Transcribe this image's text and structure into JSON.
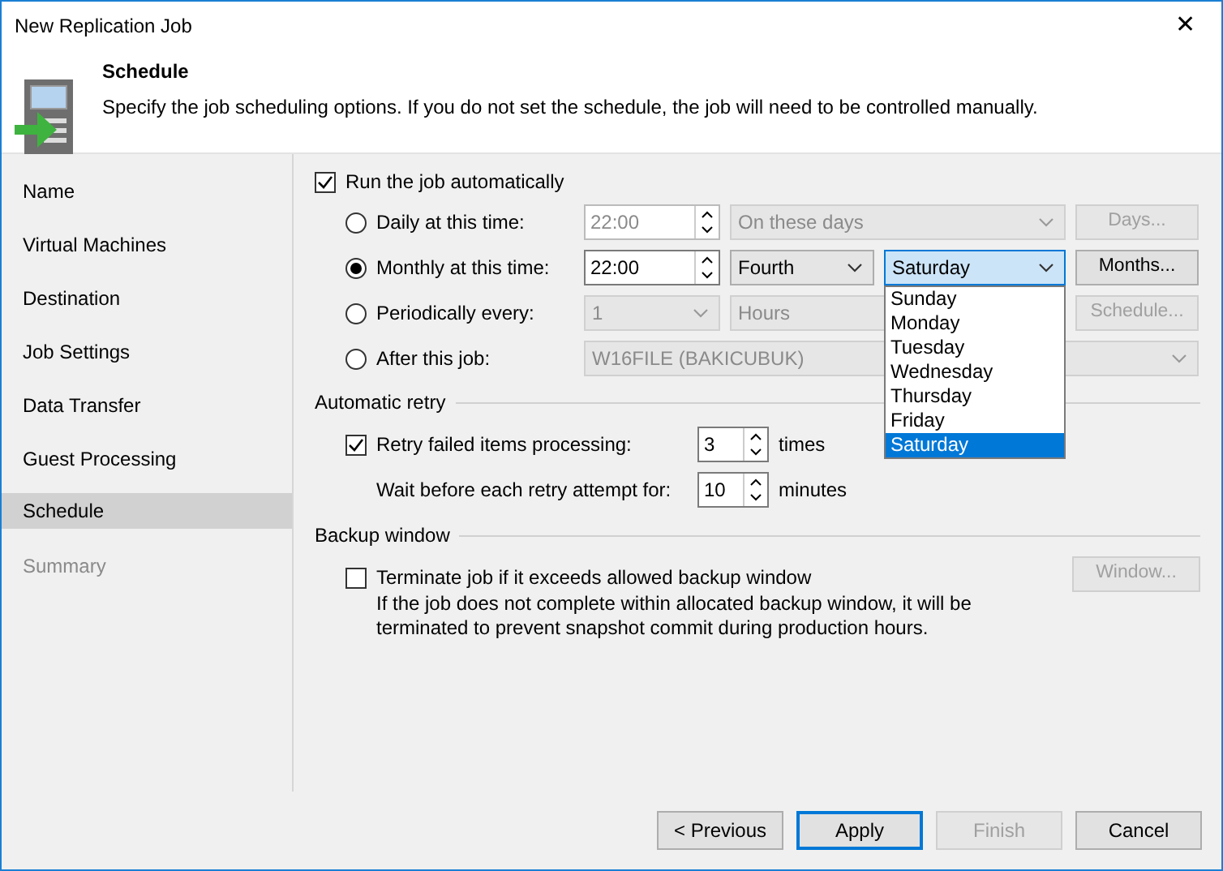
{
  "window": {
    "title": "New Replication Job",
    "close": "✕"
  },
  "header": {
    "title": "Schedule",
    "description": "Specify the job scheduling options. If you do not set the schedule, the job will need to be controlled manually."
  },
  "sidebar": {
    "items": [
      {
        "label": "Name",
        "selected": false,
        "disabled": false
      },
      {
        "label": "Virtual Machines",
        "selected": false,
        "disabled": false
      },
      {
        "label": "Destination",
        "selected": false,
        "disabled": false
      },
      {
        "label": "Job Settings",
        "selected": false,
        "disabled": false
      },
      {
        "label": "Data Transfer",
        "selected": false,
        "disabled": false
      },
      {
        "label": "Guest Processing",
        "selected": false,
        "disabled": false
      },
      {
        "label": "Schedule",
        "selected": true,
        "disabled": false
      },
      {
        "label": "Summary",
        "selected": false,
        "disabled": true
      }
    ]
  },
  "run_automatically": {
    "label": "Run the job automatically",
    "checked": true
  },
  "options": [
    {
      "label": "Daily at this time:",
      "selected": false,
      "controls": [
        {
          "kind": "spinner",
          "value": "22:00",
          "disabled": true
        },
        {
          "kind": "combo-wide",
          "value": "On these days",
          "disabled": true
        },
        {
          "kind": "button",
          "value": "Days...",
          "disabled": true
        }
      ]
    },
    {
      "label": "Monthly at this time:",
      "selected": true,
      "controls": [
        {
          "kind": "spinner",
          "value": "22:00",
          "disabled": false
        },
        {
          "kind": "combo",
          "value": "Fourth",
          "disabled": false
        },
        {
          "kind": "combo",
          "value": "Saturday",
          "disabled": false,
          "focused": true,
          "open_list": [
            {
              "label": "Sunday",
              "selected": false
            },
            {
              "label": "Monday",
              "selected": false
            },
            {
              "label": "Tuesday",
              "selected": false
            },
            {
              "label": "Wednesday",
              "selected": false
            },
            {
              "label": "Thursday",
              "selected": false
            },
            {
              "label": "Friday",
              "selected": false
            },
            {
              "label": "Saturday",
              "selected": true
            }
          ]
        },
        {
          "kind": "button",
          "value": "Months...",
          "disabled": false
        }
      ]
    },
    {
      "label": "Periodically every:",
      "selected": false,
      "controls": [
        {
          "kind": "combo",
          "value": "1",
          "disabled": true
        },
        {
          "kind": "combo-wide",
          "value": "Hours",
          "disabled": true
        },
        {
          "kind": "button",
          "value": "Schedule...",
          "disabled": true
        }
      ]
    },
    {
      "label": "After this job:",
      "selected": false,
      "controls": [
        {
          "kind": "combo-full",
          "value": "W16FILE (BAKICUBUK)",
          "disabled": true
        }
      ]
    }
  ],
  "automatic_retry": {
    "title": "Automatic retry",
    "rows": [
      {
        "kind": "checkbox",
        "label": "Retry failed items processing:",
        "checked": true,
        "value": "3",
        "unit": "times"
      },
      {
        "kind": "plain",
        "label": "Wait before each retry attempt for:",
        "value": "10",
        "unit": "minutes"
      }
    ]
  },
  "backup_window": {
    "title": "Backup window",
    "label": "Terminate job if it exceeds allowed backup window",
    "checked": false,
    "description": "If the job does not complete within allocated backup window, it will be terminated to prevent snapshot commit during production hours.",
    "button": {
      "label": "Window...",
      "disabled": true
    }
  },
  "footer_buttons": [
    {
      "label": "< Previous",
      "disabled": false,
      "default": false
    },
    {
      "label": "Apply",
      "disabled": false,
      "default": true
    },
    {
      "label": "Finish",
      "disabled": true,
      "default": false
    },
    {
      "label": "Cancel",
      "disabled": false,
      "default": false
    }
  ]
}
